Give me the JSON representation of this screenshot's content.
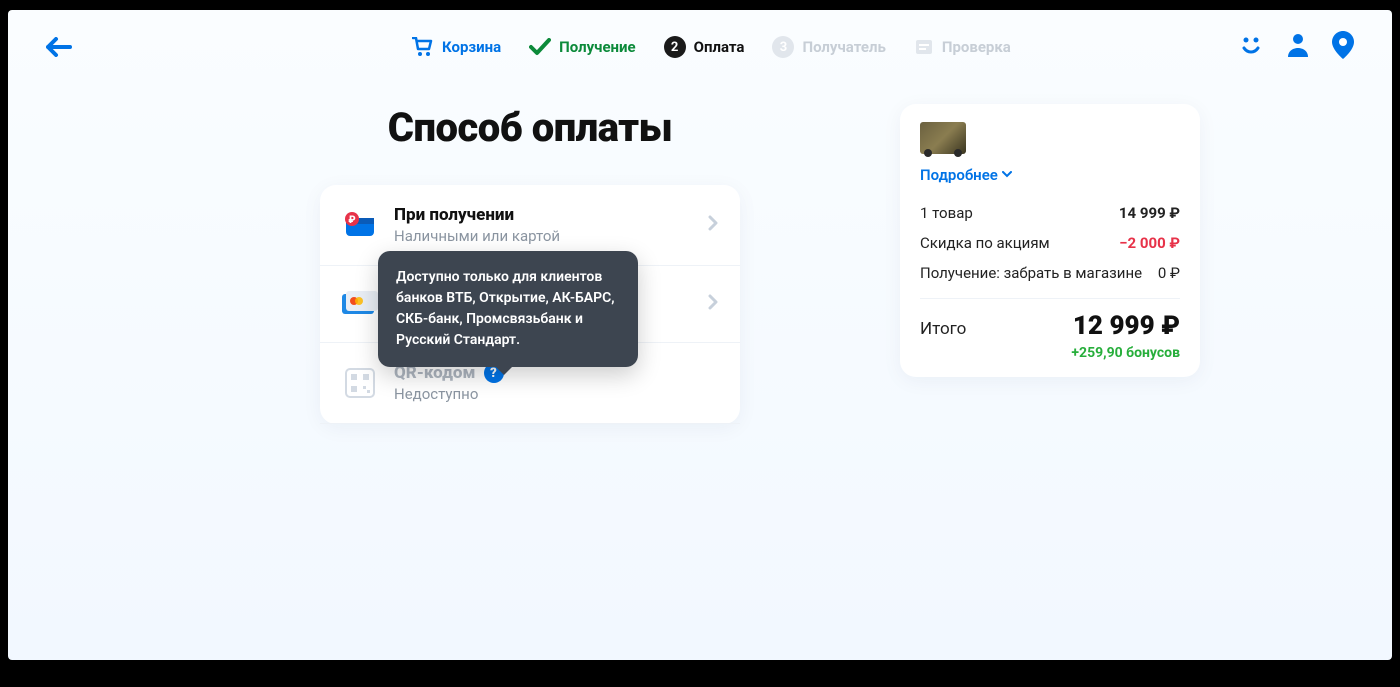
{
  "steps": {
    "cart": "Корзина",
    "delivery": "Получение",
    "payment": "Оплата",
    "payment_num": "2",
    "recipient": "Получатель",
    "recipient_num": "3",
    "check": "Проверка"
  },
  "title": "Способ оплаты",
  "options": {
    "on_receive_title": "При получении",
    "on_receive_sub": "Наличными или картой",
    "qr_title": "QR-кодом",
    "qr_sub": "Недоступно",
    "qr_help": "?"
  },
  "tooltip": "Доступно только для клиентов банков ВТБ, Открытие, АК-БАРС, СКБ-банк, Промсвязьбанк и Русский Стандарт.",
  "summary": {
    "more": "Подробнее",
    "items_label": "1 товар",
    "items_value": "14 999 ₽",
    "discount_label": "Скидка по акциям",
    "discount_value": "−2 000 ₽",
    "delivery_label": "Получение: забрать в магазине",
    "delivery_value": "0 ₽",
    "total_label": "Итого",
    "total_value": "12 999 ₽",
    "bonus": "+259,90 бонусов"
  }
}
